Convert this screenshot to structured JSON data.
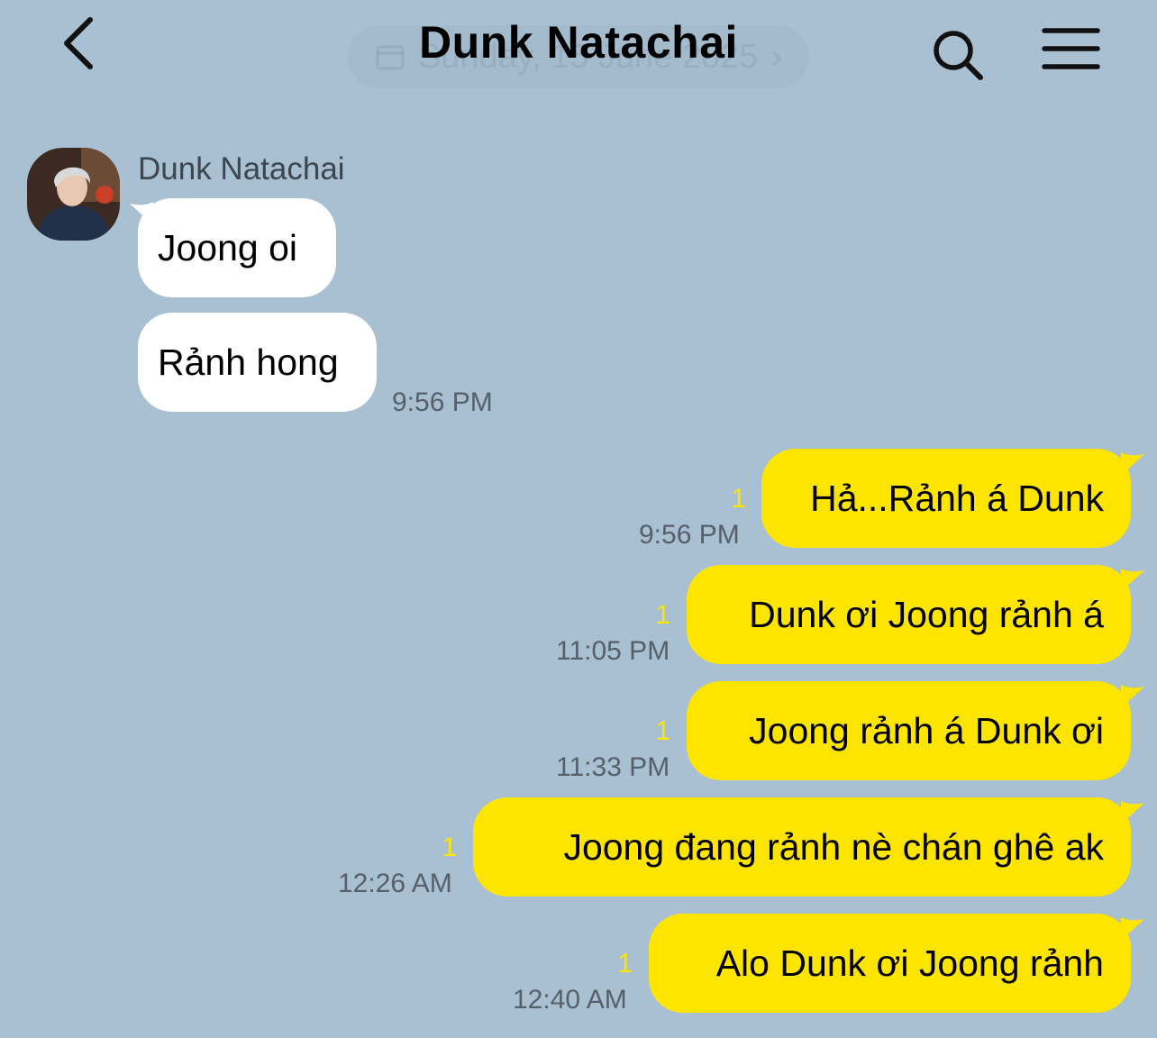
{
  "header": {
    "title": "Dunk Natachai",
    "date_pill": "Sunday, 15 June 2025"
  },
  "incoming": {
    "sender": "Dunk Natachai",
    "messages": [
      {
        "text": "Joong oi"
      },
      {
        "text": "Rảnh hong",
        "time": "9:56 PM"
      }
    ]
  },
  "outgoing": [
    {
      "text": "Hả...Rảnh á Dunk",
      "time": "9:56 PM",
      "unread": "1"
    },
    {
      "text": "Dunk ơi Joong rảnh á",
      "time": "11:05 PM",
      "unread": "1"
    },
    {
      "text": "Joong rảnh á Dunk ơi",
      "time": "11:33 PM",
      "unread": "1"
    },
    {
      "text": "Joong đang rảnh nè chán ghê ak",
      "time": "12:26 AM",
      "unread": "1"
    },
    {
      "text": "Alo Dunk ơi Joong rảnh",
      "time": "12:40 AM",
      "unread": "1"
    }
  ],
  "colors": {
    "background": "#a9bfd2",
    "outgoing_bubble": "#fee500",
    "incoming_bubble": "#ffffff"
  },
  "icons": [
    "back-arrow-icon",
    "calendar-icon",
    "search-icon",
    "menu-icon",
    "chevron-right-icon"
  ]
}
